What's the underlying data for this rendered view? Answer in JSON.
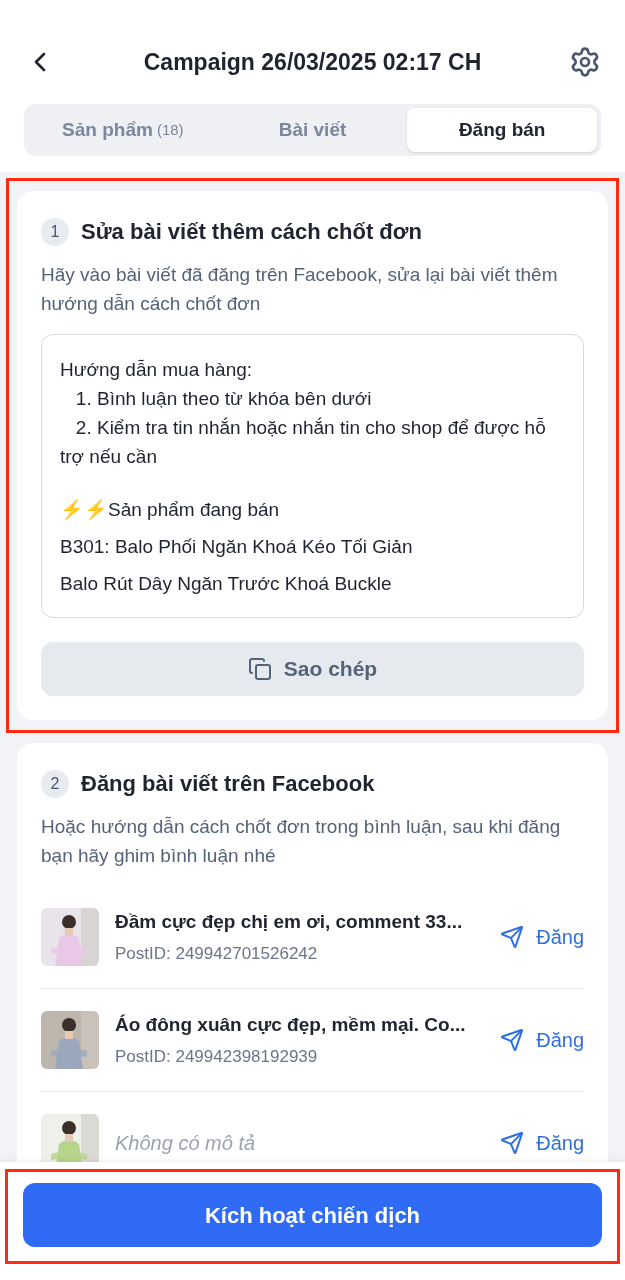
{
  "header": {
    "title": "Campaign 26/03/2025 02:17 CH"
  },
  "tabs": [
    {
      "label": "Sản phẩm",
      "count": "(18)",
      "selected": false
    },
    {
      "label": "Bài viết",
      "selected": false
    },
    {
      "label": "Đăng bán",
      "selected": true
    }
  ],
  "steps": [
    {
      "number": "1",
      "title": "Sửa bài viết thêm cách chốt đơn",
      "description": "Hãy vào bài viết đã đăng trên Facebook, sửa lại bài viết thêm hướng dẫn cách chốt đơn",
      "post_text": [
        [
          "Hướng dẫn mua hàng:",
          "   1. Bình luận theo từ khóa bên dưới",
          "   2. Kiểm tra tin nhắn hoặc nhắn tin cho shop để được hỗ trợ nếu cần"
        ],
        [
          "⚡⚡Sản phẩm đang bán",
          "B301: Balo Phối Ngăn Khoá Kéo Tối Giản",
          "Balo Rút Dây Ngăn Trước Khoá Buckle"
        ]
      ],
      "copy_button": "Sao chép"
    },
    {
      "number": "2",
      "title": "Đăng bài viết trên Facebook",
      "description": "Hoặc hướng dẫn cách chốt đơn trong bình luận, sau khi đăng bạn hãy ghim bình luận nhé",
      "posts": [
        {
          "kind": "text",
          "title": "Đầm cực đẹp chị em ơi, comment 33...",
          "post_id": "PostID: 249942701526242",
          "action": "Đăng"
        },
        {
          "kind": "text",
          "title": "Áo đông xuân cực đẹp, mềm mại. Co...",
          "post_id": "PostID: 249942398192939",
          "action": "Đăng"
        },
        {
          "kind": "empty",
          "title": "Không có mô tả",
          "action": "Đăng"
        }
      ]
    }
  ],
  "activate_button": "Kích hoạt chiến dịch"
}
